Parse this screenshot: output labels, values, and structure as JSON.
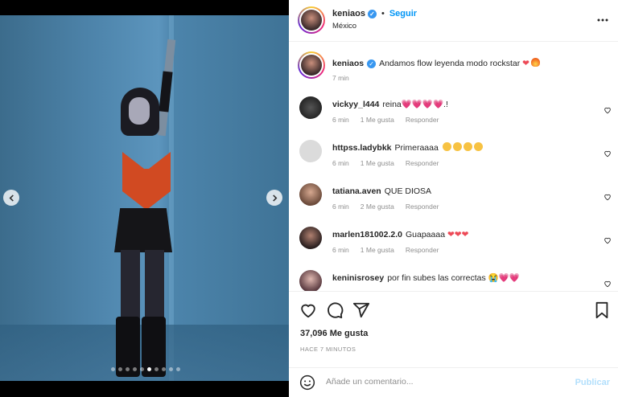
{
  "post": {
    "username": "keniaos",
    "follow_label": "Seguir",
    "location": "México",
    "more_icon": "more-horizontal-icon",
    "separator": "•"
  },
  "media": {
    "carousel": {
      "dot_count": 10,
      "active_index": 5
    },
    "prev_icon": "chevron-left-icon",
    "next_icon": "chevron-right-icon"
  },
  "caption": {
    "username": "keniaos",
    "text": "Andamos flow leyenda modo rockstar",
    "emojis": [
      "red-heart",
      "fire"
    ],
    "time": "7 min"
  },
  "comments": [
    {
      "username": "vickyy_l444",
      "text": "reina💗💗💗💗.!",
      "time": "6 min",
      "likes": "1 Me gusta",
      "reply": "Responder"
    },
    {
      "username": "httpss.ladybkk",
      "text": "Primeraaaa",
      "emojis": [
        "heart-eyes",
        "heart-eyes",
        "heart-eyes",
        "heart-eyes"
      ],
      "time": "6 min",
      "likes": "1 Me gusta",
      "reply": "Responder"
    },
    {
      "username": "tatiana.aven",
      "text": "QUE DIOSA",
      "time": "6 min",
      "likes": "2 Me gusta",
      "reply": "Responder"
    },
    {
      "username": "marlen181002.2.0",
      "text": "Guapaaaa",
      "emojis": [
        "red-heart",
        "red-heart",
        "red-heart"
      ],
      "time": "6 min",
      "likes": "1 Me gusta",
      "reply": "Responder"
    },
    {
      "username": "keninisrosey",
      "text": "por fin subes las correctas 😭💗💗"
    }
  ],
  "actions": {
    "like_icon": "heart-icon",
    "comment_icon": "comment-icon",
    "share_icon": "share-icon",
    "save_icon": "bookmark-icon",
    "likes_count": "37,096 Me gusta",
    "time_ago": "HACE 7 MINUTOS"
  },
  "composer": {
    "placeholder": "Añade un comentario...",
    "publish_label": "Publicar",
    "emoji_icon": "smiley-icon"
  },
  "colors": {
    "accent": "#0095f6",
    "verified": "#3897f0",
    "heart": "#ed4956",
    "publish_disabled": "#b2dffc"
  }
}
